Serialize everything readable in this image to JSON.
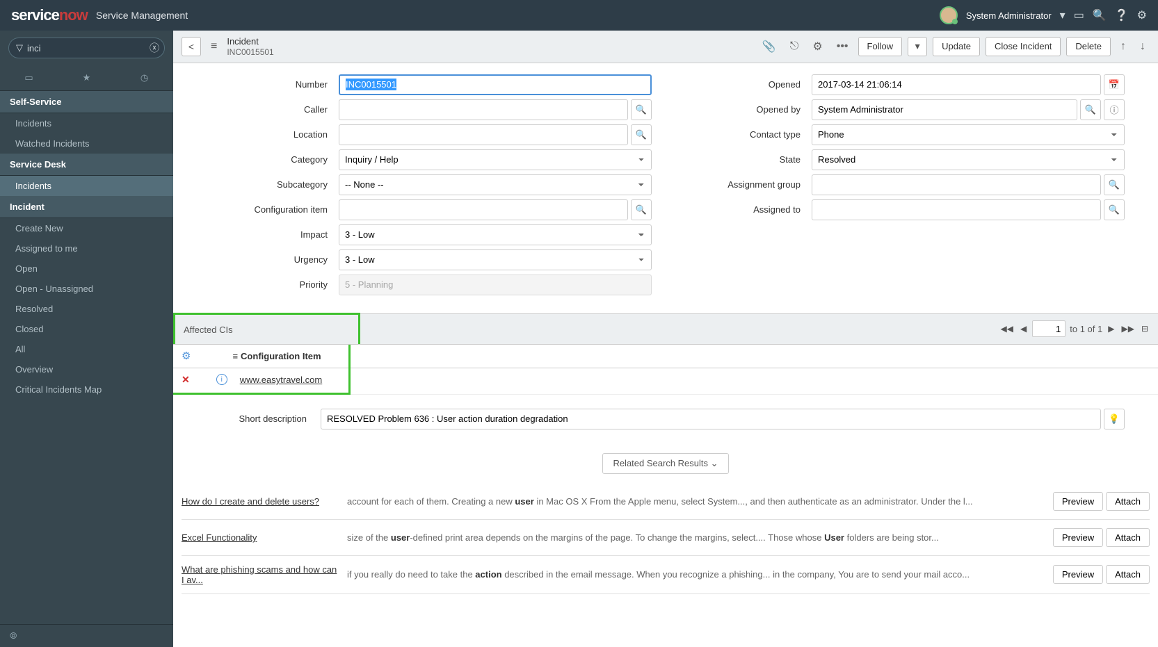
{
  "top": {
    "logo1": "service",
    "logo2": "now",
    "product": "Service Management",
    "user": "System Administrator"
  },
  "filter": {
    "value": "inci"
  },
  "nav": {
    "app1": "Self-Service",
    "a1i1": "Incidents",
    "a1i2": "Watched Incidents",
    "app2": "Service Desk",
    "a2i1": "Incidents",
    "app3": "Incident",
    "a3i1": "Create New",
    "a3i2": "Assigned to me",
    "a3i3": "Open",
    "a3i4": "Open - Unassigned",
    "a3i5": "Resolved",
    "a3i6": "Closed",
    "a3i7": "All",
    "a3i8": "Overview",
    "a3i9": "Critical Incidents Map"
  },
  "hdr": {
    "title": "Incident",
    "sub": "INC0015501",
    "follow": "Follow",
    "update": "Update",
    "close": "Close Incident",
    "delete": "Delete"
  },
  "form": {
    "number_label": "Number",
    "number": "INC0015501",
    "caller_label": "Caller",
    "location_label": "Location",
    "category_label": "Category",
    "category": "Inquiry / Help",
    "subcategory_label": "Subcategory",
    "subcategory": "-- None --",
    "ci_label": "Configuration item",
    "impact_label": "Impact",
    "impact": "3 - Low",
    "urgency_label": "Urgency",
    "urgency": "3 - Low",
    "priority_label": "Priority",
    "priority": "5 - Planning",
    "opened_label": "Opened",
    "opened": "2017-03-14 21:06:14",
    "openedby_label": "Opened by",
    "openedby": "System Administrator",
    "contact_label": "Contact type",
    "contact": "Phone",
    "state_label": "State",
    "state": "Resolved",
    "assgrp_label": "Assignment group",
    "assto_label": "Assigned to"
  },
  "aff": {
    "title": "Affected CIs",
    "page_val": "1",
    "page_range": "to 1 of 1",
    "col1": "Configuration Item",
    "row1_link": "www.easytravel.com"
  },
  "desc": {
    "label": "Short description",
    "value": "RESOLVED Problem 636 : User action duration degradation"
  },
  "related": {
    "btn": "Related Search Results"
  },
  "sr": [
    {
      "title": "How do I create and delete users?",
      "body_pre": "account for each of them. Creating a new ",
      "body_b1": "user",
      "body_mid": " in Mac OS X From the Apple menu, select System..., and then authenticate as an administrator.  Under the l..."
    },
    {
      "title": "Excel Functionality",
      "body_pre": "size of the ",
      "body_b1": "user",
      "body_mid": "-defined print area depends on the margins of the page. To change the margins, select.... Those whose ",
      "body_b2": "User",
      "body_post": " folders are being stor..."
    },
    {
      "title": "What are phishing scams and how can I av...",
      "body_pre": "if you really do need to take the ",
      "body_b1": "action",
      "body_mid": " described in the email message. When you recognize a phishing... in the company, You are to send your mail acco..."
    }
  ],
  "actions": {
    "preview": "Preview",
    "attach": "Attach"
  }
}
